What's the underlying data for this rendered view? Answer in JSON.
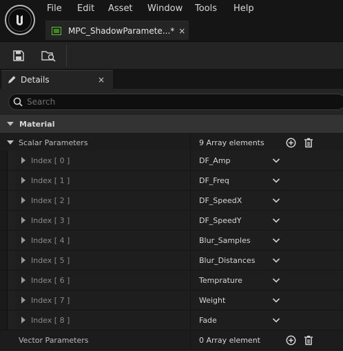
{
  "menu": [
    "File",
    "Edit",
    "Asset",
    "Window",
    "Tools",
    "Help"
  ],
  "document_tab": {
    "label": "MPC_ShadowParamete...*",
    "close": "×"
  },
  "details_tab": {
    "label": "Details",
    "close": "×"
  },
  "search": {
    "placeholder": "Search"
  },
  "category": {
    "label": "Material"
  },
  "scalar": {
    "label": "Scalar Parameters",
    "count": "9 Array elements",
    "items": [
      {
        "index": "Index [ 0 ]",
        "value": "DF_Amp"
      },
      {
        "index": "Index [ 1 ]",
        "value": "DF_Freq"
      },
      {
        "index": "Index [ 2 ]",
        "value": "DF_SpeedX"
      },
      {
        "index": "Index [ 3 ]",
        "value": "DF_SpeedY"
      },
      {
        "index": "Index [ 4 ]",
        "value": "Blur_Samples"
      },
      {
        "index": "Index [ 5 ]",
        "value": "Blur_Distances"
      },
      {
        "index": "Index [ 6 ]",
        "value": "Temprature"
      },
      {
        "index": "Index [ 7 ]",
        "value": "Weight"
      },
      {
        "index": "Index [ 8 ]",
        "value": "Fade"
      }
    ]
  },
  "vector": {
    "label": "Vector Parameters",
    "count": "0 Array element"
  },
  "icons": {
    "logo": "unreal-logo-icon",
    "save": "save-icon",
    "browse": "browse-asset-icon",
    "details": "pencil-icon",
    "search": "search-icon",
    "add": "add-circle-icon",
    "delete": "trash-icon",
    "expand": "triangle-right-icon",
    "collapse": "triangle-down-icon",
    "dropdown": "chevron-down-icon"
  },
  "colors": {
    "accent_green": "#5cbf3a",
    "panel": "#242424",
    "background": "#151515"
  }
}
